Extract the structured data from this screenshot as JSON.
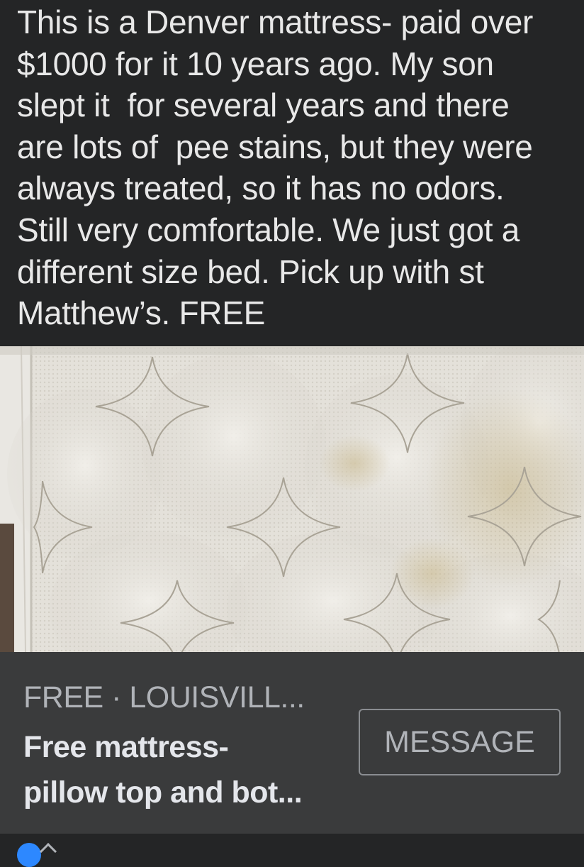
{
  "post": {
    "text": "This is a Denver mattress- paid over\n$1000 for it 10 years ago. My son\nslept it  for several years and there\nare lots of  pee stains, but they were\nalways treated, so it has no odors.\nStill very comfortable. We just got a\ndifferent size bed. Pick up with st\nMatthew’s. FREE"
  },
  "photo": {
    "subject": "quilted white pillow-top mattress with faint stains"
  },
  "listing": {
    "price_location": "FREE · LOUISVILL...",
    "title": "Free mattress-\npillow top and bot...",
    "message_label": "MESSAGE"
  },
  "colors": {
    "background": "#242526",
    "card": "#3a3b3c",
    "text_primary": "#e4e6eb",
    "text_secondary": "#b0b3b8",
    "accent": "#2d88ff"
  },
  "icons": {
    "profile": "avatar-icon"
  }
}
